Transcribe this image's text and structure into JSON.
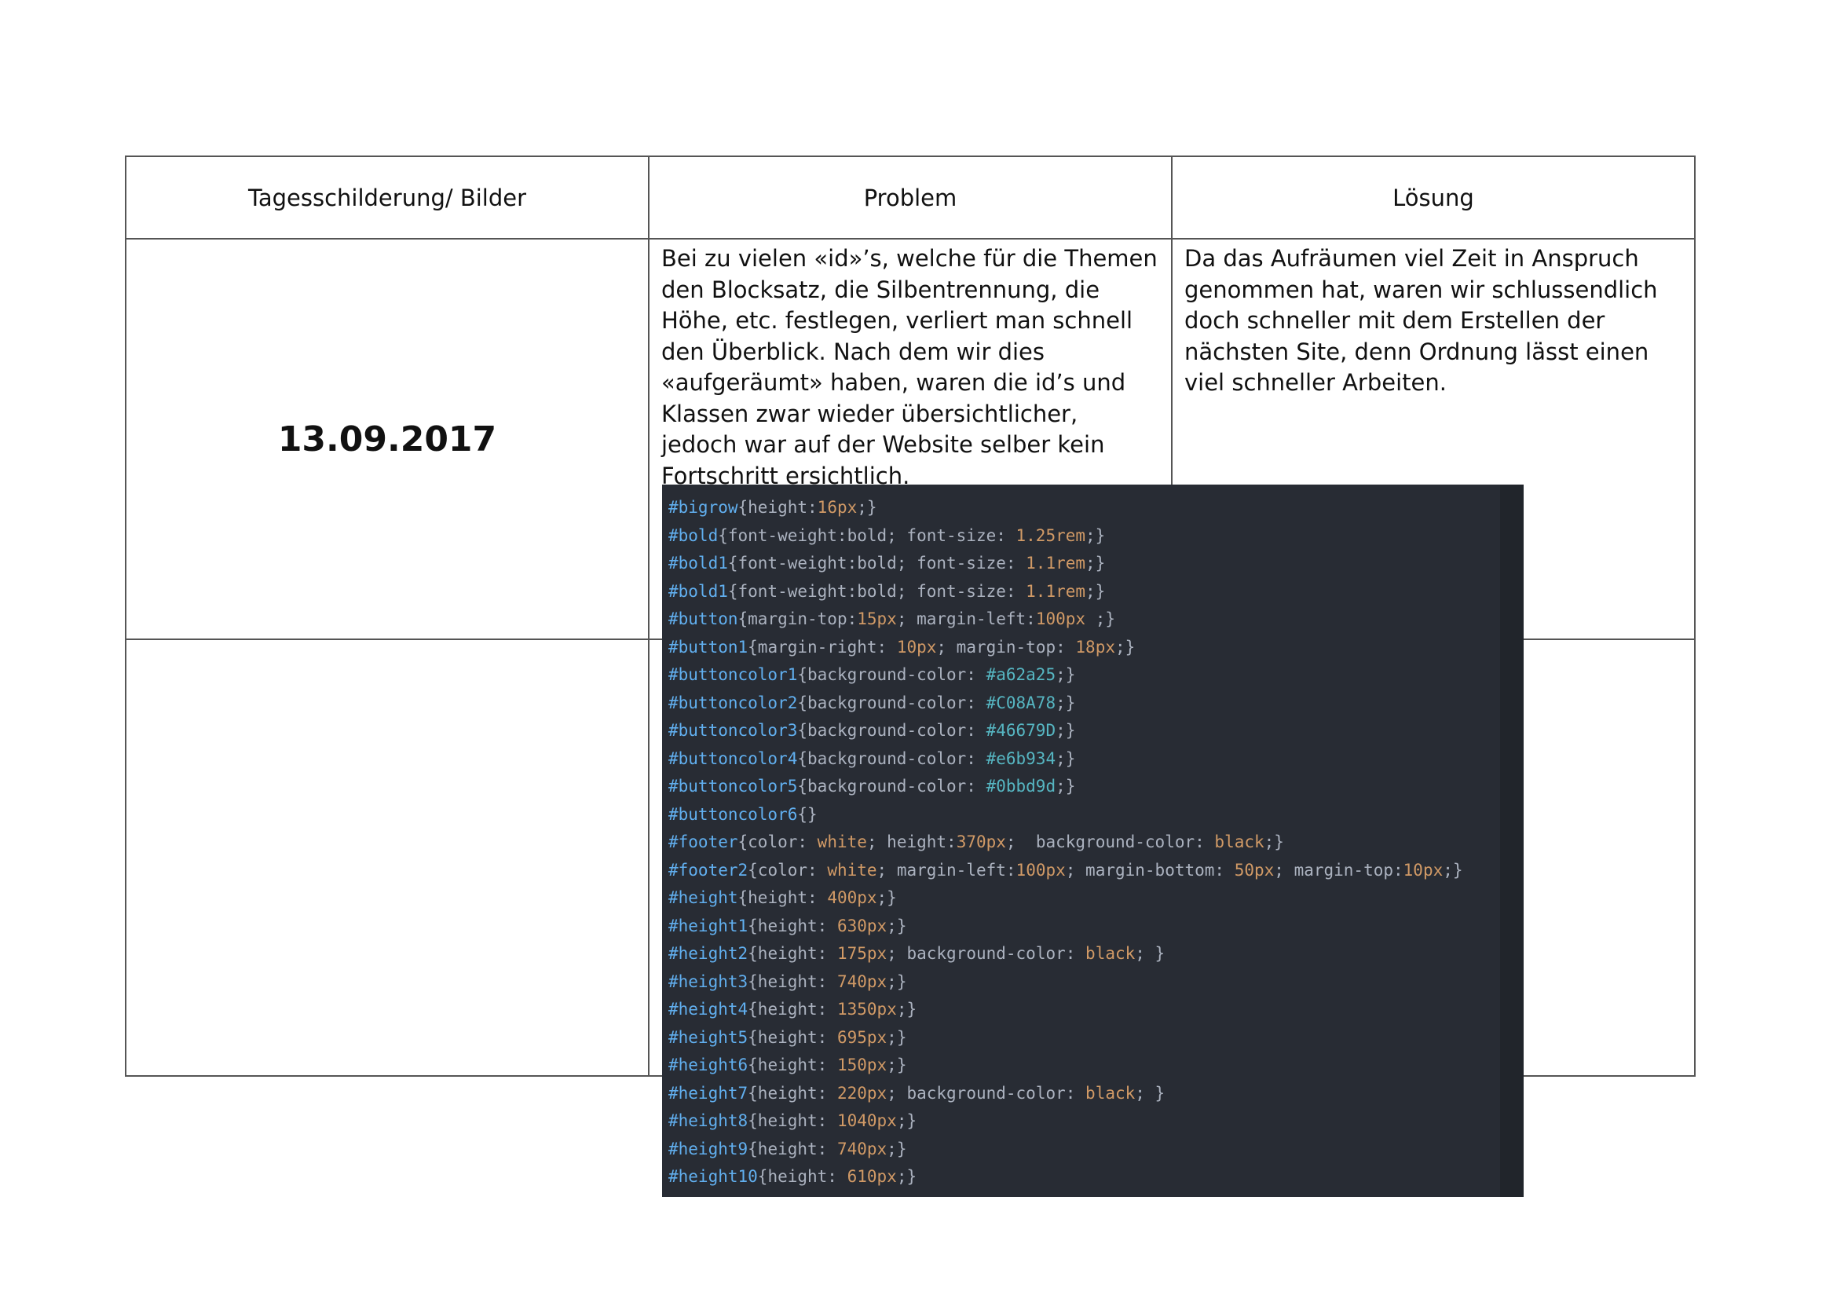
{
  "table": {
    "headers": {
      "day": "Tagesschilderung/ Bilder",
      "problem": "Problem",
      "solution": "Lösung"
    },
    "rows": [
      {
        "date": "13.09.2017",
        "problem": "Bei zu vielen «id»’s, welche für die Themen den Blocksatz, die Silbentrennung, die Höhe, etc. festlegen, verliert man schnell den Überblick. Nach dem wir dies «aufgeräumt» haben, waren die id’s und Klassen zwar wieder übersichtlicher, jedoch war auf der Website selber kein Fortschritt ersichtlich.",
        "solution": "Da das Aufräumen viel Zeit in Anspruch genommen hat, waren wir schlussendlich doch schneller mit dem Erstellen der nächsten Site, denn Ordnung lässt einen viel schneller Arbeiten."
      },
      {
        "date": "",
        "problem": "",
        "solution": ""
      }
    ]
  },
  "code": {
    "colors": {
      "background": "#282c34",
      "selector": "#61afef",
      "number": "#d19a66",
      "hex": "#56b6c2",
      "text": "#abb2bf"
    },
    "lines": [
      [
        {
          "t": "#bigrow",
          "c": "sel"
        },
        {
          "t": "{height:"
        },
        {
          "t": "16px",
          "c": "num"
        },
        {
          "t": ";}"
        }
      ],
      [
        {
          "t": "#bold",
          "c": "sel"
        },
        {
          "t": "{font-weight:bold; font-size: "
        },
        {
          "t": "1.25rem",
          "c": "num"
        },
        {
          "t": ";}"
        }
      ],
      [
        {
          "t": "#bold1",
          "c": "sel"
        },
        {
          "t": "{font-weight:bold; font-size: "
        },
        {
          "t": "1.1rem",
          "c": "num"
        },
        {
          "t": ";}"
        }
      ],
      [
        {
          "t": "#bold1",
          "c": "sel"
        },
        {
          "t": "{font-weight:bold; font-size: "
        },
        {
          "t": "1.1rem",
          "c": "num"
        },
        {
          "t": ";}"
        }
      ],
      [
        {
          "t": "#button",
          "c": "sel"
        },
        {
          "t": "{margin-top:"
        },
        {
          "t": "15px",
          "c": "num"
        },
        {
          "t": "; margin-left:"
        },
        {
          "t": "100px",
          "c": "num"
        },
        {
          "t": " ;}"
        }
      ],
      [
        {
          "t": "#button1",
          "c": "sel"
        },
        {
          "t": "{margin-right: "
        },
        {
          "t": "10px",
          "c": "num"
        },
        {
          "t": "; margin-top: "
        },
        {
          "t": "18px",
          "c": "num"
        },
        {
          "t": ";}"
        }
      ],
      [
        {
          "t": "#buttoncolor1",
          "c": "sel"
        },
        {
          "t": "{background-color: "
        },
        {
          "t": "#a62a25",
          "c": "hex"
        },
        {
          "t": ";}"
        }
      ],
      [
        {
          "t": "#buttoncolor2",
          "c": "sel"
        },
        {
          "t": "{background-color: "
        },
        {
          "t": "#C08A78",
          "c": "hex"
        },
        {
          "t": ";}"
        }
      ],
      [
        {
          "t": "#buttoncolor3",
          "c": "sel"
        },
        {
          "t": "{background-color: "
        },
        {
          "t": "#46679D",
          "c": "hex"
        },
        {
          "t": ";}"
        }
      ],
      [
        {
          "t": "#buttoncolor4",
          "c": "sel"
        },
        {
          "t": "{background-color: "
        },
        {
          "t": "#e6b934",
          "c": "hex"
        },
        {
          "t": ";}"
        }
      ],
      [
        {
          "t": "#buttoncolor5",
          "c": "sel"
        },
        {
          "t": "{background-color: "
        },
        {
          "t": "#0bbd9d",
          "c": "hex"
        },
        {
          "t": ";}"
        }
      ],
      [
        {
          "t": "#buttoncolor6",
          "c": "sel"
        },
        {
          "t": "{}"
        }
      ],
      [
        {
          "t": "#footer",
          "c": "sel"
        },
        {
          "t": "{color: "
        },
        {
          "t": "white",
          "c": "kw"
        },
        {
          "t": "; height:"
        },
        {
          "t": "370px",
          "c": "num"
        },
        {
          "t": ";  background-color: "
        },
        {
          "t": "black",
          "c": "kw"
        },
        {
          "t": ";}"
        }
      ],
      [
        {
          "t": "#footer2",
          "c": "sel"
        },
        {
          "t": "{color: "
        },
        {
          "t": "white",
          "c": "kw"
        },
        {
          "t": "; margin-left:"
        },
        {
          "t": "100px",
          "c": "num"
        },
        {
          "t": "; margin-bottom: "
        },
        {
          "t": "50px",
          "c": "num"
        },
        {
          "t": "; margin-top:"
        },
        {
          "t": "10px",
          "c": "num"
        },
        {
          "t": ";}"
        }
      ],
      [
        {
          "t": "#height",
          "c": "sel"
        },
        {
          "t": "{height: "
        },
        {
          "t": "400px",
          "c": "num"
        },
        {
          "t": ";}"
        }
      ],
      [
        {
          "t": "#height1",
          "c": "sel"
        },
        {
          "t": "{height: "
        },
        {
          "t": "630px",
          "c": "num"
        },
        {
          "t": ";}"
        }
      ],
      [
        {
          "t": "#height2",
          "c": "sel"
        },
        {
          "t": "{height: "
        },
        {
          "t": "175px",
          "c": "num"
        },
        {
          "t": "; background-color: "
        },
        {
          "t": "black",
          "c": "kw"
        },
        {
          "t": "; }"
        }
      ],
      [
        {
          "t": "#height3",
          "c": "sel"
        },
        {
          "t": "{height: "
        },
        {
          "t": "740px",
          "c": "num"
        },
        {
          "t": ";}"
        }
      ],
      [
        {
          "t": "#height4",
          "c": "sel"
        },
        {
          "t": "{height: "
        },
        {
          "t": "1350px",
          "c": "num"
        },
        {
          "t": ";}"
        }
      ],
      [
        {
          "t": "#height5",
          "c": "sel"
        },
        {
          "t": "{height: "
        },
        {
          "t": "695px",
          "c": "num"
        },
        {
          "t": ";}"
        }
      ],
      [
        {
          "t": "#height6",
          "c": "sel"
        },
        {
          "t": "{height: "
        },
        {
          "t": "150px",
          "c": "num"
        },
        {
          "t": ";}"
        }
      ],
      [
        {
          "t": "#height7",
          "c": "sel"
        },
        {
          "t": "{height: "
        },
        {
          "t": "220px",
          "c": "num"
        },
        {
          "t": "; background-color: "
        },
        {
          "t": "black",
          "c": "kw"
        },
        {
          "t": "; }"
        }
      ],
      [
        {
          "t": "#height8",
          "c": "sel"
        },
        {
          "t": "{height: "
        },
        {
          "t": "1040px",
          "c": "num"
        },
        {
          "t": ";}"
        }
      ],
      [
        {
          "t": "#height9",
          "c": "sel"
        },
        {
          "t": "{height: "
        },
        {
          "t": "740px",
          "c": "num"
        },
        {
          "t": ";}"
        }
      ],
      [
        {
          "t": "#height10",
          "c": "sel"
        },
        {
          "t": "{height: "
        },
        {
          "t": "610px",
          "c": "num"
        },
        {
          "t": ";}"
        }
      ]
    ]
  }
}
